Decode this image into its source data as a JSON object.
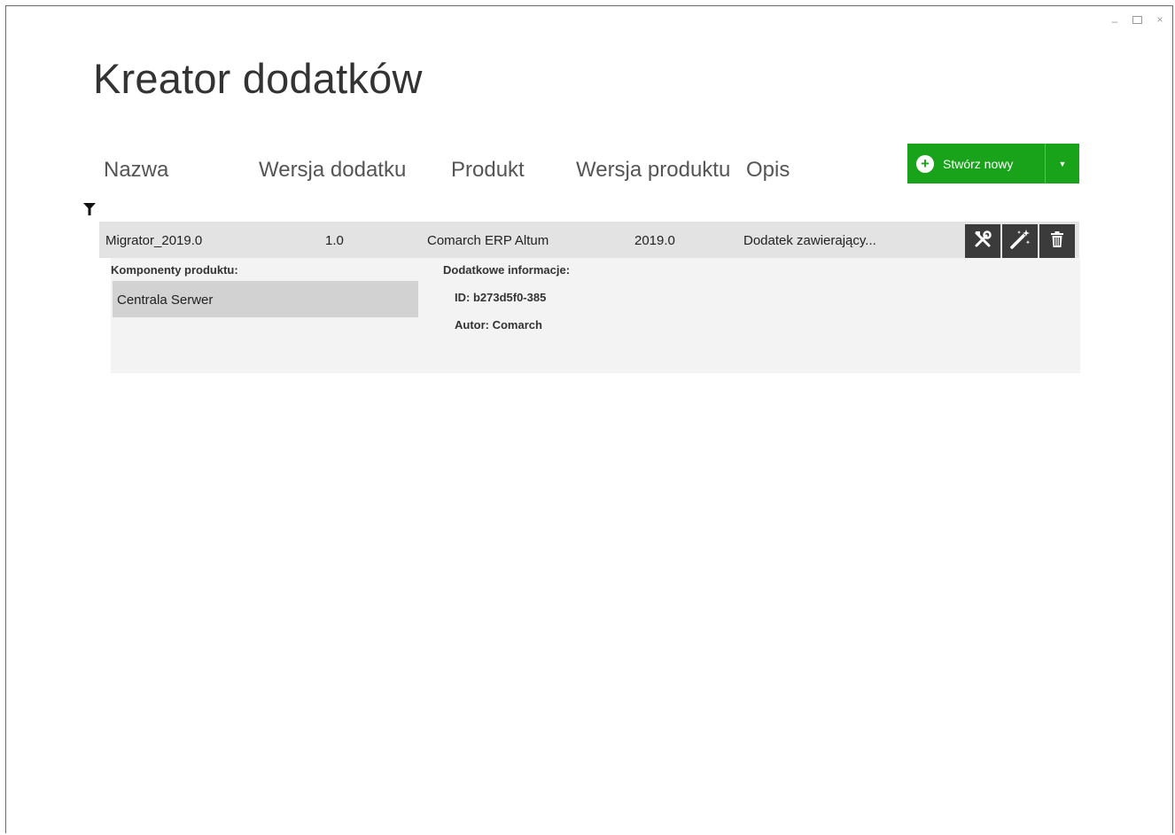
{
  "window": {
    "controls": [
      "–",
      "□",
      "×"
    ]
  },
  "title": "Kreator dodatków",
  "columns": {
    "name": "Nazwa",
    "addon_version": "Wersja dodatku",
    "product": "Produkt",
    "product_version": "Wersja produktu",
    "description": "Opis"
  },
  "create_button": {
    "label": "Stwórz nowy",
    "icon": "plus-circle-icon",
    "dropdown_icon": "caret-down-icon",
    "color": "#18a31b"
  },
  "filter": {
    "icon": "filter-icon"
  },
  "row": {
    "name": "Migrator_2019.0",
    "addon_version": "1.0",
    "product": "Comarch ERP Altum",
    "product_version": "2019.0",
    "description": "Dodatek zawierający...",
    "actions": [
      {
        "name": "tools-icon"
      },
      {
        "name": "magic-wand-icon"
      },
      {
        "name": "trash-icon"
      }
    ]
  },
  "details": {
    "components_label": "Komponenty produktu:",
    "components": [
      "Centrala Serwer"
    ],
    "info_label": "Dodatkowe informacje:",
    "id_text": "ID: b273d5f0-385",
    "author_text": "Autor: Comarch"
  }
}
